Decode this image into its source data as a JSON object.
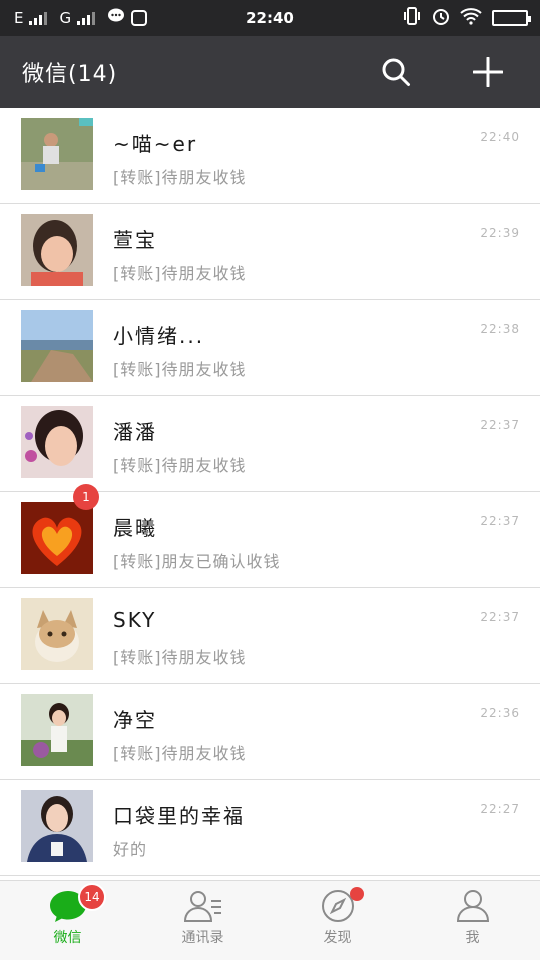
{
  "statusbar": {
    "carrier1": "E",
    "carrier2": "G",
    "time": "22:40"
  },
  "header": {
    "title": "微信(14)",
    "icons": [
      "search-icon",
      "plus-icon"
    ]
  },
  "chats": [
    {
      "name": "~喵~er",
      "preview": "[转账]待朋友收钱",
      "time": "22:40",
      "avatar_color": "#8a9a6a"
    },
    {
      "name": "萱宝",
      "preview": "[转账]待朋友收钱",
      "time": "22:39",
      "avatar_color": "#c9886a"
    },
    {
      "name": "小情绪...",
      "preview": "[转账]待朋友收钱",
      "time": "22:38",
      "avatar_color": "#8fb1d6"
    },
    {
      "name": "潘潘",
      "preview": "[转账]待朋友收钱",
      "time": "22:37",
      "avatar_color": "#b07a6a"
    },
    {
      "name": "晨曦",
      "preview": "[转账]朋友已确认收钱",
      "time": "22:37",
      "avatar_color": "#e04a1a",
      "unread": "1"
    },
    {
      "name": "SKY",
      "preview": "[转账]待朋友收钱",
      "time": "22:37",
      "avatar_color": "#d8c8a8"
    },
    {
      "name": "净空",
      "preview": "[转账]待朋友收钱",
      "time": "22:36",
      "avatar_color": "#8aa080"
    },
    {
      "name": "口袋里的幸福",
      "preview": "好的",
      "time": "22:27",
      "avatar_color": "#4a5a8a"
    }
  ],
  "tabs": [
    {
      "label": "微信",
      "icon": "chat-bubble-icon",
      "badge": "14"
    },
    {
      "label": "通讯录",
      "icon": "contacts-icon"
    },
    {
      "label": "发现",
      "icon": "compass-icon"
    },
    {
      "label": "我",
      "icon": "person-icon"
    }
  ],
  "colors": {
    "header_bg": "#3a3a3e",
    "statusbar_bg": "#262628",
    "accent_green": "#1aad19",
    "badge_red": "#e64340"
  }
}
